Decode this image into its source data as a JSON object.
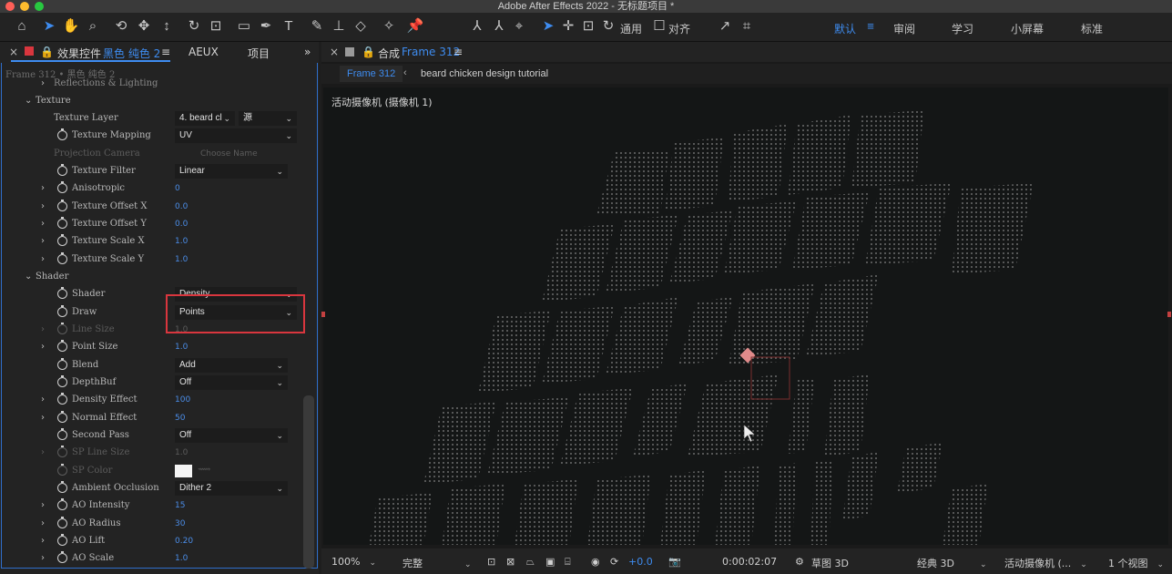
{
  "window": {
    "title": "Adobe After Effects 2022 - 无标题项目 *"
  },
  "toolbar": {
    "universal_label": "通用",
    "snap_label": "对齐",
    "workspaces": [
      "默认",
      "审阅",
      "学习",
      "小屏幕",
      "标准"
    ]
  },
  "left_panel": {
    "tab_effect_controls": "效果控件",
    "tab_layer_name": "黑色 纯色 2",
    "tab_aeux": "AEUX",
    "tab_project": "项目",
    "breadcrumb": "Frame 312 • 黑色 纯色 2",
    "rows": {
      "reflections": "Reflections & Lighting",
      "texture": "Texture",
      "texture_layer": "Texture Layer",
      "texture_layer_value": "4. beard cl",
      "texture_layer_source": "源",
      "texture_mapping": "Texture Mapping",
      "texture_mapping_value": "UV",
      "projection_camera": "Projection Camera",
      "projection_camera_value": "Choose Name",
      "texture_filter": "Texture Filter",
      "texture_filter_value": "Linear",
      "anisotropic": "Anisotropic",
      "anisotropic_value": "0",
      "texture_offset_x": "Texture Offset X",
      "texture_offset_x_value": "0.0",
      "texture_offset_y": "Texture Offset Y",
      "texture_offset_y_value": "0.0",
      "texture_scale_x": "Texture Scale X",
      "texture_scale_x_value": "1.0",
      "texture_scale_y": "Texture Scale Y",
      "texture_scale_y_value": "1.0",
      "shader": "Shader",
      "shader_item": "Shader",
      "shader_value": "Density",
      "draw": "Draw",
      "draw_value": "Points",
      "line_size": "Line Size",
      "line_size_value": "1.0",
      "point_size": "Point Size",
      "point_size_value": "1.0",
      "blend": "Blend",
      "blend_value": "Add",
      "depthbuf": "DepthBuf",
      "depthbuf_value": "Off",
      "density_effect": "Density Effect",
      "density_effect_value": "100",
      "normal_effect": "Normal Effect",
      "normal_effect_value": "50",
      "second_pass": "Second Pass",
      "second_pass_value": "Off",
      "sp_line_size": "SP Line Size",
      "sp_line_size_value": "1.0",
      "sp_color": "SP Color",
      "ambient_occlusion": "Ambient Occlusion",
      "ambient_occlusion_value": "Dither 2",
      "ao_intensity": "AO Intensity",
      "ao_intensity_value": "15",
      "ao_radius": "AO Radius",
      "ao_radius_value": "30",
      "ao_lift": "AO Lift",
      "ao_lift_value": "0.20",
      "ao_scale": "AO Scale",
      "ao_scale_value": "1.0"
    }
  },
  "comp_panel": {
    "tab_label": "合成",
    "comp_name": "Frame 312",
    "breadcrumb_current": "Frame 312",
    "breadcrumb_next": "beard chicken design tutorial",
    "camera_label": "活动摄像机 (摄像机 1)"
  },
  "viewer_footer": {
    "zoom": "100%",
    "resolution": "完整",
    "exposure": "+0.0",
    "timecode": "0:00:02:07",
    "draft3d": "草图 3D",
    "renderer": "经典 3D",
    "camera": "活动摄像机 (...",
    "views": "1 个视图"
  },
  "colors": {
    "accent": "#3e8cf0",
    "highlight_box": "#d9363e",
    "panel_border": "#2f6fcb"
  }
}
